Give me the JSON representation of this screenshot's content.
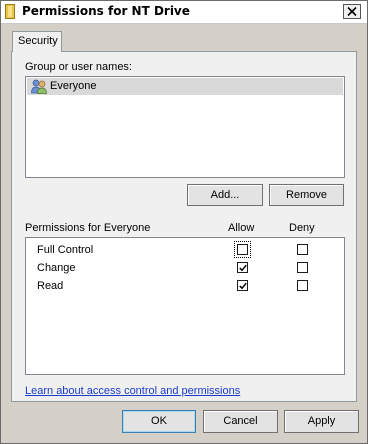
{
  "window": {
    "title": "Permissions for NT Drive"
  },
  "tabs": [
    {
      "label": "Security",
      "selected": true
    }
  ],
  "security": {
    "group_label": "Group or user names:",
    "users": [
      {
        "name": "Everyone",
        "icon": "users-group-icon",
        "selected": true
      }
    ],
    "add_button": "Add...",
    "remove_button": "Remove",
    "permissions_label": "Permissions for Everyone",
    "allow_header": "Allow",
    "deny_header": "Deny",
    "permissions": [
      {
        "name": "Full Control",
        "allow": false,
        "deny": false
      },
      {
        "name": "Change",
        "allow": true,
        "deny": false
      },
      {
        "name": "Read",
        "allow": true,
        "deny": false
      }
    ],
    "help_link": "Learn about access control and permissions"
  },
  "footer": {
    "ok": "OK",
    "cancel": "Cancel",
    "apply": "Apply"
  }
}
